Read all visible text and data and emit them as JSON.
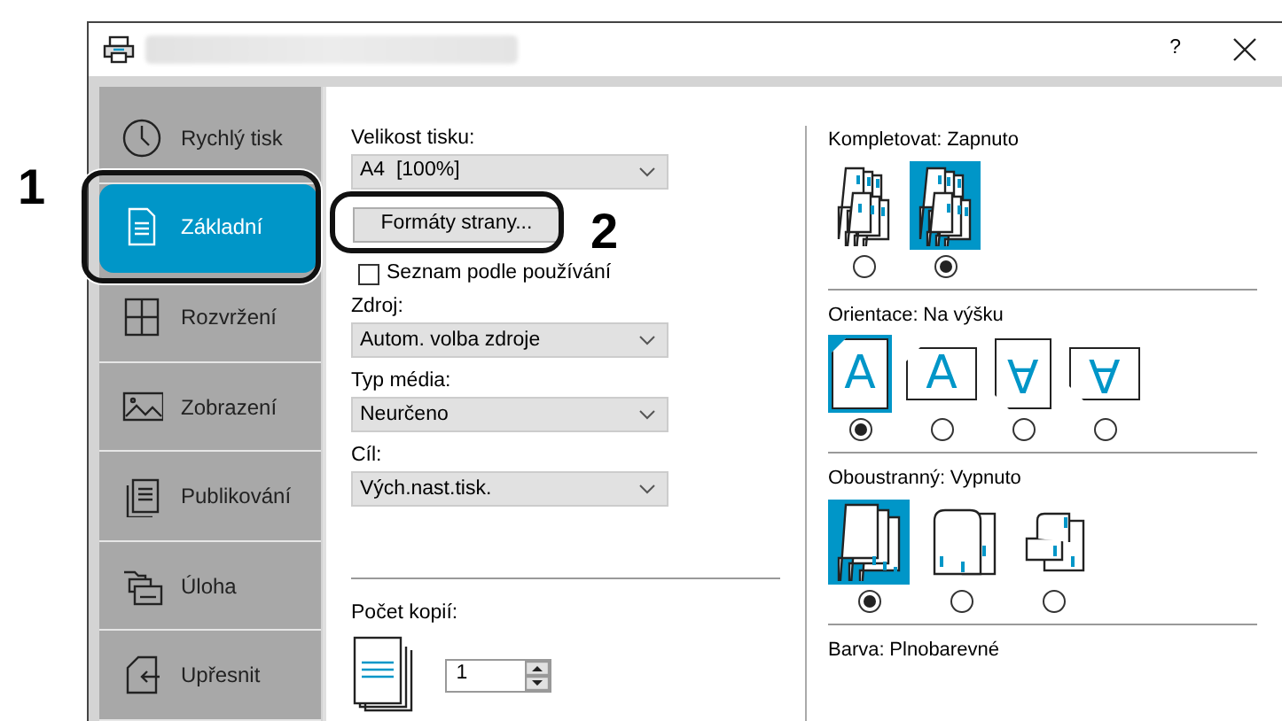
{
  "window": {
    "help": "?"
  },
  "sidebar": {
    "items": [
      {
        "label": "Rychlý tisk",
        "selected": false
      },
      {
        "label": "Základní",
        "selected": true
      },
      {
        "label": "Rozvržení",
        "selected": false
      },
      {
        "label": "Zobrazení",
        "selected": false
      },
      {
        "label": "Publikování",
        "selected": false
      },
      {
        "label": "Úloha",
        "selected": false
      },
      {
        "label": "Upřesnit",
        "selected": false
      }
    ]
  },
  "print_size": {
    "label": "Velikost tisku:",
    "value": "A4  [100%]"
  },
  "page_formats_button": "Formáty strany...",
  "list_by_usage": {
    "label": "Seznam podle používání",
    "checked": false
  },
  "selects": [
    {
      "label": "Zdroj:",
      "value": "Autom. volba zdroje"
    },
    {
      "label": "Typ média:",
      "value": "Neurčeno"
    },
    {
      "label": "Cíl:",
      "value": "Vých.nast.tisk."
    }
  ],
  "copies": {
    "label": "Počet kopií:",
    "value": "1"
  },
  "groups": [
    {
      "label": "Kompletovat:",
      "value": "Zapnuto",
      "options": [
        {
          "selected": false
        },
        {
          "selected": true
        }
      ]
    },
    {
      "label": "Orientace:",
      "value": "Na výšku",
      "options": [
        {
          "selected": true,
          "glyph": "A"
        },
        {
          "selected": false,
          "glyph": "A"
        },
        {
          "selected": false,
          "glyph": "A"
        },
        {
          "selected": false,
          "glyph": "A"
        }
      ]
    },
    {
      "label": "Oboustranný:",
      "value": "Vypnuto",
      "options": [
        {
          "selected": true
        },
        {
          "selected": false
        },
        {
          "selected": false
        }
      ]
    }
  ],
  "color": {
    "label": "Barva:",
    "value": "Plnobarevné"
  },
  "callouts": [
    {
      "label": "1"
    },
    {
      "label": "2"
    }
  ]
}
